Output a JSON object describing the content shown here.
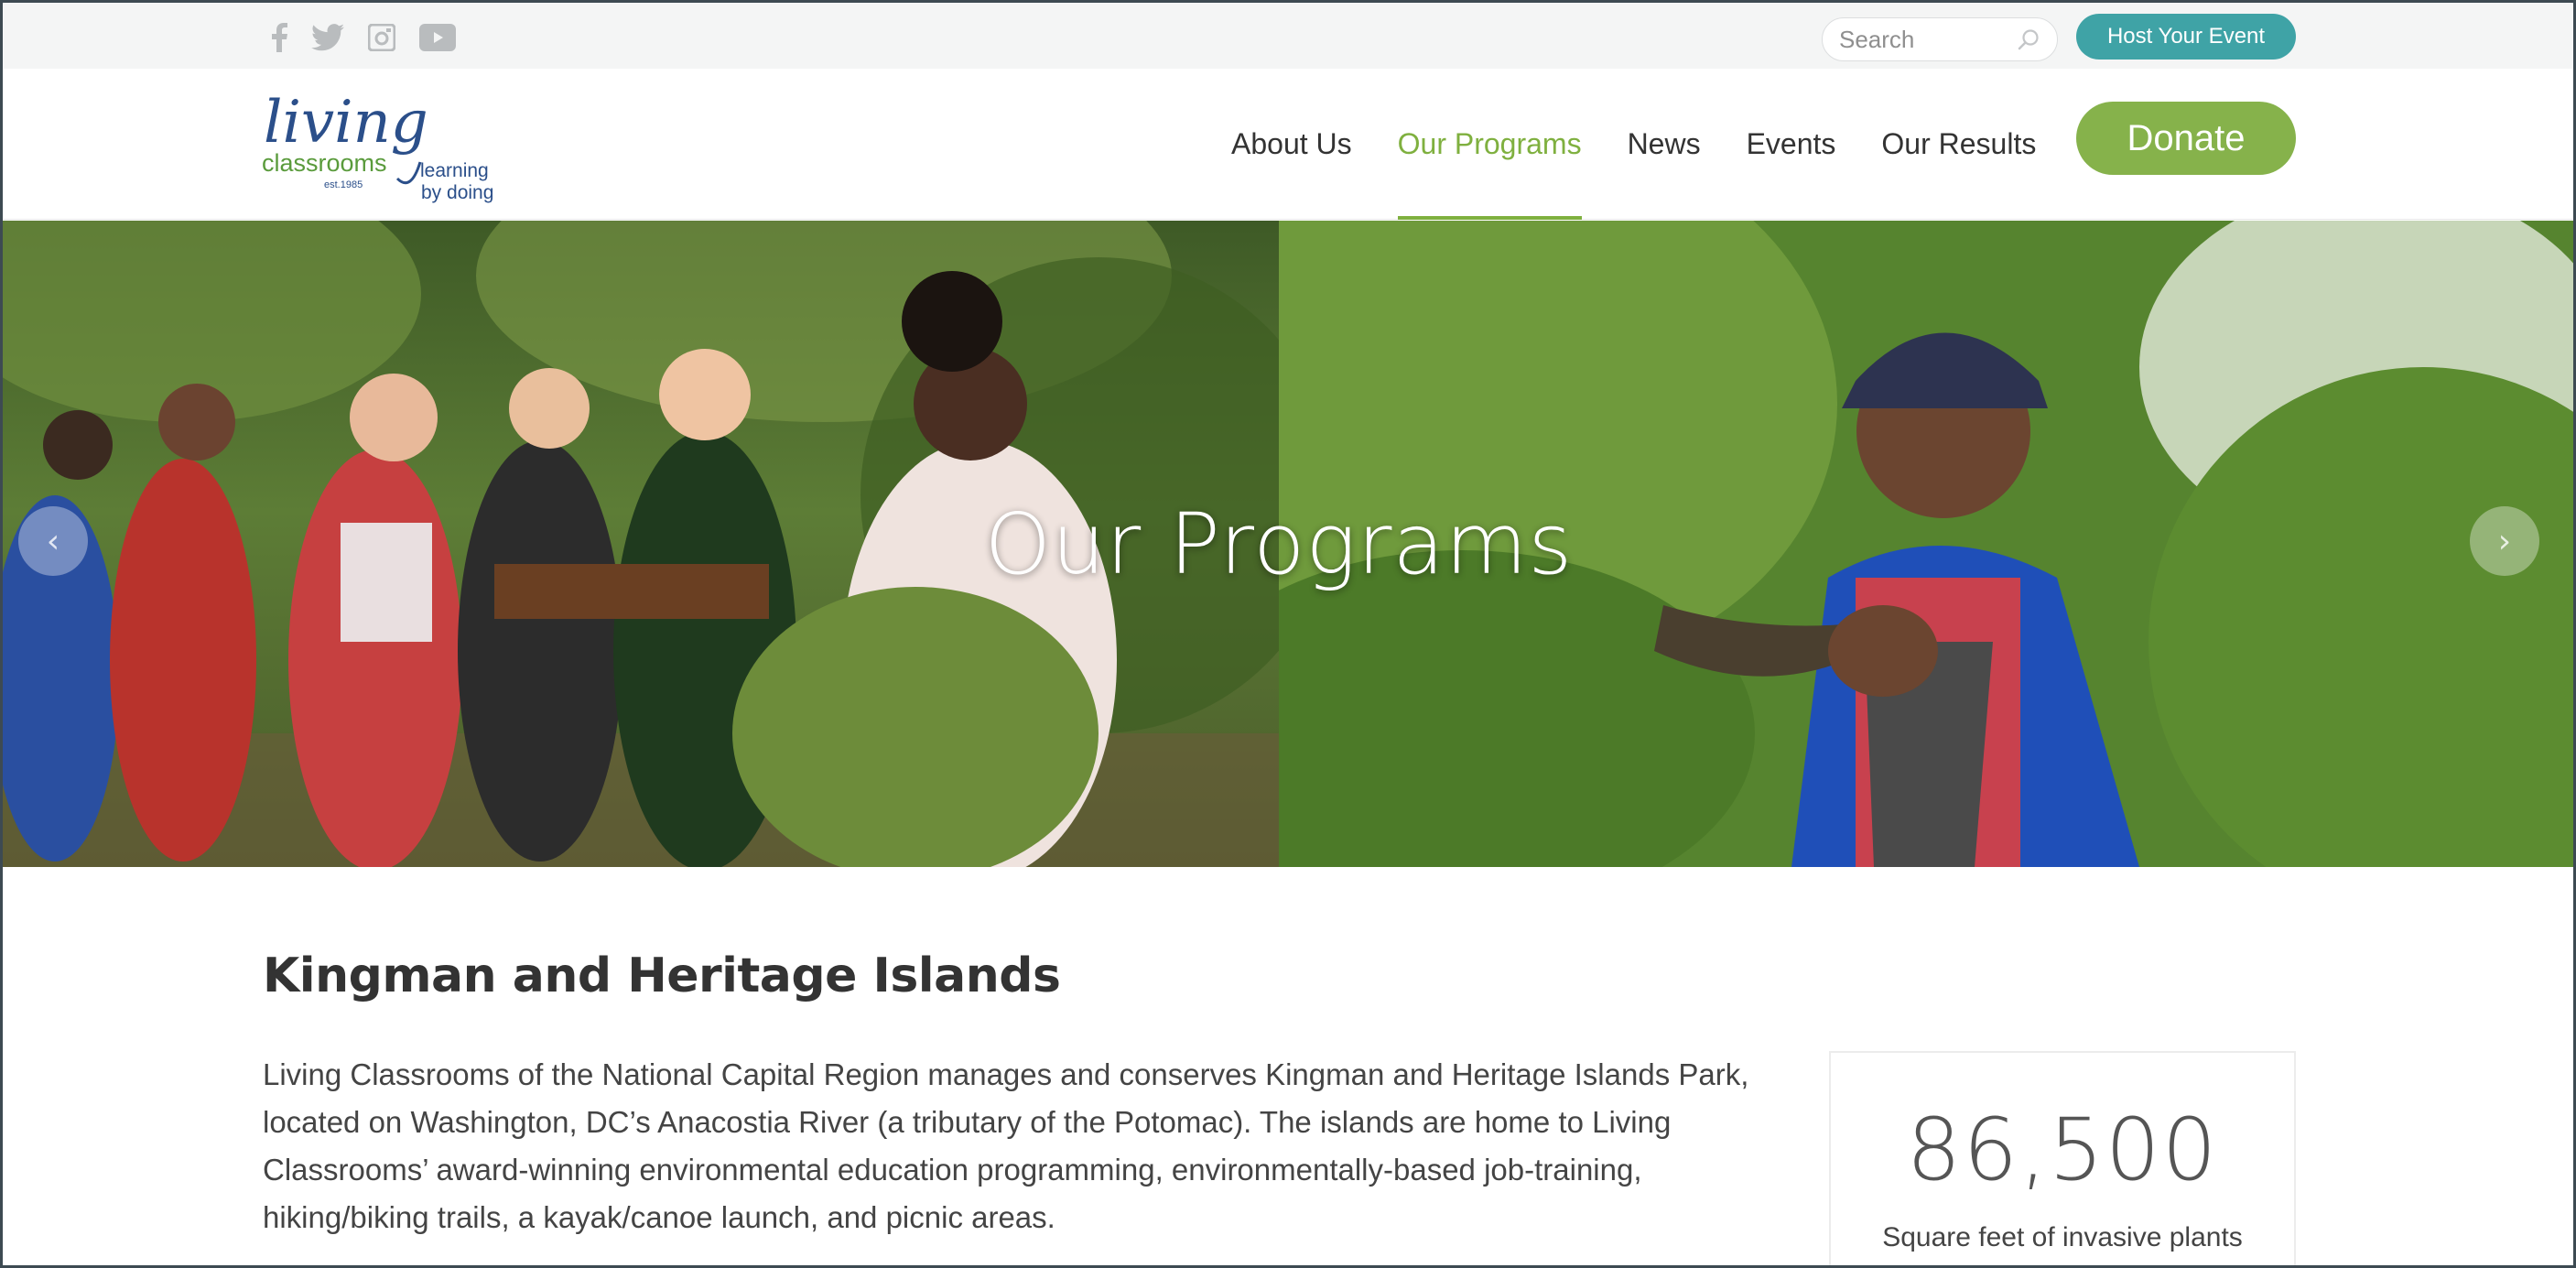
{
  "utility_bar": {
    "social_icons": [
      "facebook-icon",
      "twitter-icon",
      "instagram-icon",
      "youtube-icon"
    ],
    "search_placeholder": "Search",
    "host_event_label": "Host Your Event"
  },
  "header": {
    "logo": {
      "wordmark": "living",
      "subword": "classrooms",
      "established": "est.1985",
      "tagline_line1": "learning",
      "tagline_line2": "by doing"
    },
    "nav": [
      {
        "label": "About Us",
        "active": false
      },
      {
        "label": "Our Programs",
        "active": true
      },
      {
        "label": "News",
        "active": false
      },
      {
        "label": "Events",
        "active": false
      },
      {
        "label": "Our Results",
        "active": false
      }
    ],
    "donate_label": "Donate"
  },
  "hero": {
    "title": "Our Programs",
    "prev_arrow": "‹",
    "next_arrow": "›"
  },
  "content": {
    "title": "Kingman and Heritage Islands",
    "body": "Living Classrooms of the National Capital Region manages and conserves Kingman and Heritage Islands Park, located on Washington, DC’s Anacostia River (a tributary of the Potomac). The islands are home to Living Classrooms’ award-winning environmental education programming, environmentally-based job-training, hiking/biking trails, a kayak/canoe launch, and picnic areas."
  },
  "stat": {
    "number": "86,500",
    "label": "Square feet of invasive plants"
  },
  "colors": {
    "accent_green": "#7fb03f",
    "donate_green": "#86b24b",
    "teal": "#3fa3a6",
    "text_dark": "#333333"
  }
}
